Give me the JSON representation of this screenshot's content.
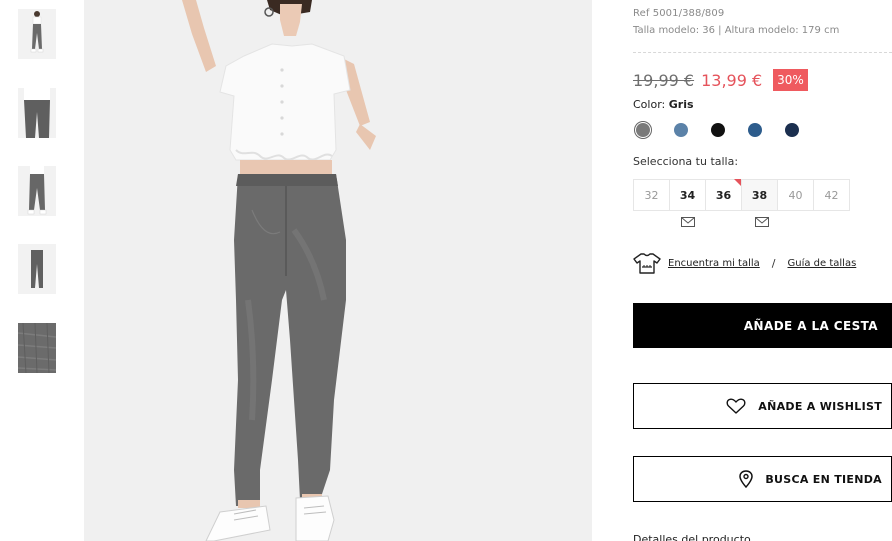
{
  "thumbnails": [
    {
      "name": "full-body-front"
    },
    {
      "name": "jeans-front"
    },
    {
      "name": "jeans-side"
    },
    {
      "name": "jeans-product"
    },
    {
      "name": "denim-fabric"
    }
  ],
  "product": {
    "ref": "Ref 5001/388/809",
    "model_info": "Talla modelo: 36 | Altura modelo: 179 cm",
    "old_price": "19,99 €",
    "new_price": "13,99 €",
    "discount": "30%",
    "color_prefix": "Color: ",
    "color_name": "Gris",
    "colors": [
      {
        "name": "gris",
        "hex": "#7a7a7a",
        "selected": true
      },
      {
        "name": "azul-claro",
        "hex": "#5b82a8",
        "selected": false
      },
      {
        "name": "negro",
        "hex": "#111111",
        "selected": false
      },
      {
        "name": "azul",
        "hex": "#2d5c8c",
        "selected": false
      },
      {
        "name": "azul-oscuro",
        "hex": "#1b2f4f",
        "selected": false
      }
    ],
    "size_prompt": "Selecciona tu talla:",
    "sizes": [
      {
        "label": "32",
        "available": false,
        "notify": false,
        "low_stock": false
      },
      {
        "label": "34",
        "available": true,
        "notify": true,
        "low_stock": false
      },
      {
        "label": "36",
        "available": true,
        "notify": false,
        "low_stock": true
      },
      {
        "label": "38",
        "available": true,
        "notify": true,
        "low_stock": false
      },
      {
        "label": "40",
        "available": false,
        "notify": false,
        "low_stock": false
      },
      {
        "label": "42",
        "available": false,
        "notify": false,
        "low_stock": false
      }
    ],
    "find_size": "Encuentra mi talla",
    "separator": "/",
    "size_guide": "Guía de tallas",
    "add_to_cart": "AÑADE A LA CESTA",
    "add_to_wishlist": "AÑADE A WISHLIST",
    "find_in_store": "BUSCA EN TIENDA",
    "details": "Detalles del producto"
  },
  "colors": {
    "sale": "#e5535b",
    "discount_bg": "#ef5a5f",
    "primary_button": "#000000"
  }
}
